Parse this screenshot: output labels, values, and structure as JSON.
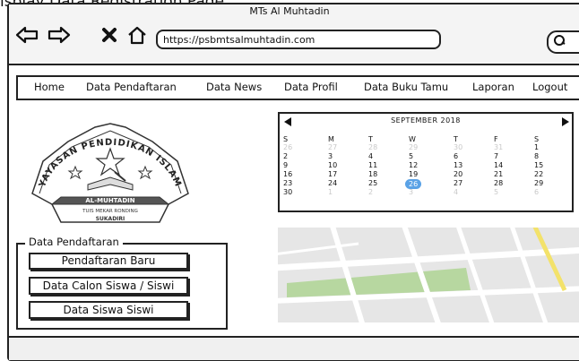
{
  "caption": "isplay Data Registration Page",
  "window": {
    "title": "MTs Al Muhtadin"
  },
  "browser": {
    "url": "https://psbmtsalmuhtadin.com",
    "back_icon": "arrow-left-icon",
    "forward_icon": "arrow-right-icon",
    "stop_icon": "close-icon",
    "home_icon": "home-icon",
    "search_icon": "search-icon"
  },
  "nav": {
    "items": [
      "Home",
      "Data Pendaftaran",
      "Data News",
      "Data Profil",
      "Data Buku Tamu",
      "Laporan",
      "Logout"
    ]
  },
  "logo": {
    "top_text": "YAYASAN PENDIDIKAN ISLAM",
    "banner_text": "AL-MUHTADIN",
    "line1": "TUIS MEKAR RONDING",
    "line2": "SUKADIRI"
  },
  "registration_panel": {
    "legend": "Data Pendaftaran",
    "buttons": [
      "Pendaftaran Baru",
      "Data Calon Siswa / Siswi",
      "Data Siswa Siswi"
    ]
  },
  "calendar": {
    "month_label": "SEPTEMBER 2018",
    "weekdays": [
      "S",
      "M",
      "T",
      "W",
      "T",
      "F",
      "S"
    ],
    "weeks": [
      [
        "26",
        "27",
        "28",
        "29",
        "30",
        "31",
        "1"
      ],
      [
        "2",
        "3",
        "4",
        "5",
        "6",
        "7",
        "8"
      ],
      [
        "9",
        "10",
        "11",
        "12",
        "13",
        "14",
        "15"
      ],
      [
        "16",
        "17",
        "18",
        "19",
        "20",
        "21",
        "22"
      ],
      [
        "23",
        "24",
        "25",
        "26",
        "27",
        "28",
        "29"
      ],
      [
        "30",
        "1",
        "2",
        "3",
        "4",
        "5",
        "6"
      ]
    ],
    "selected": "26",
    "accent_color": "#5aa2e6"
  }
}
